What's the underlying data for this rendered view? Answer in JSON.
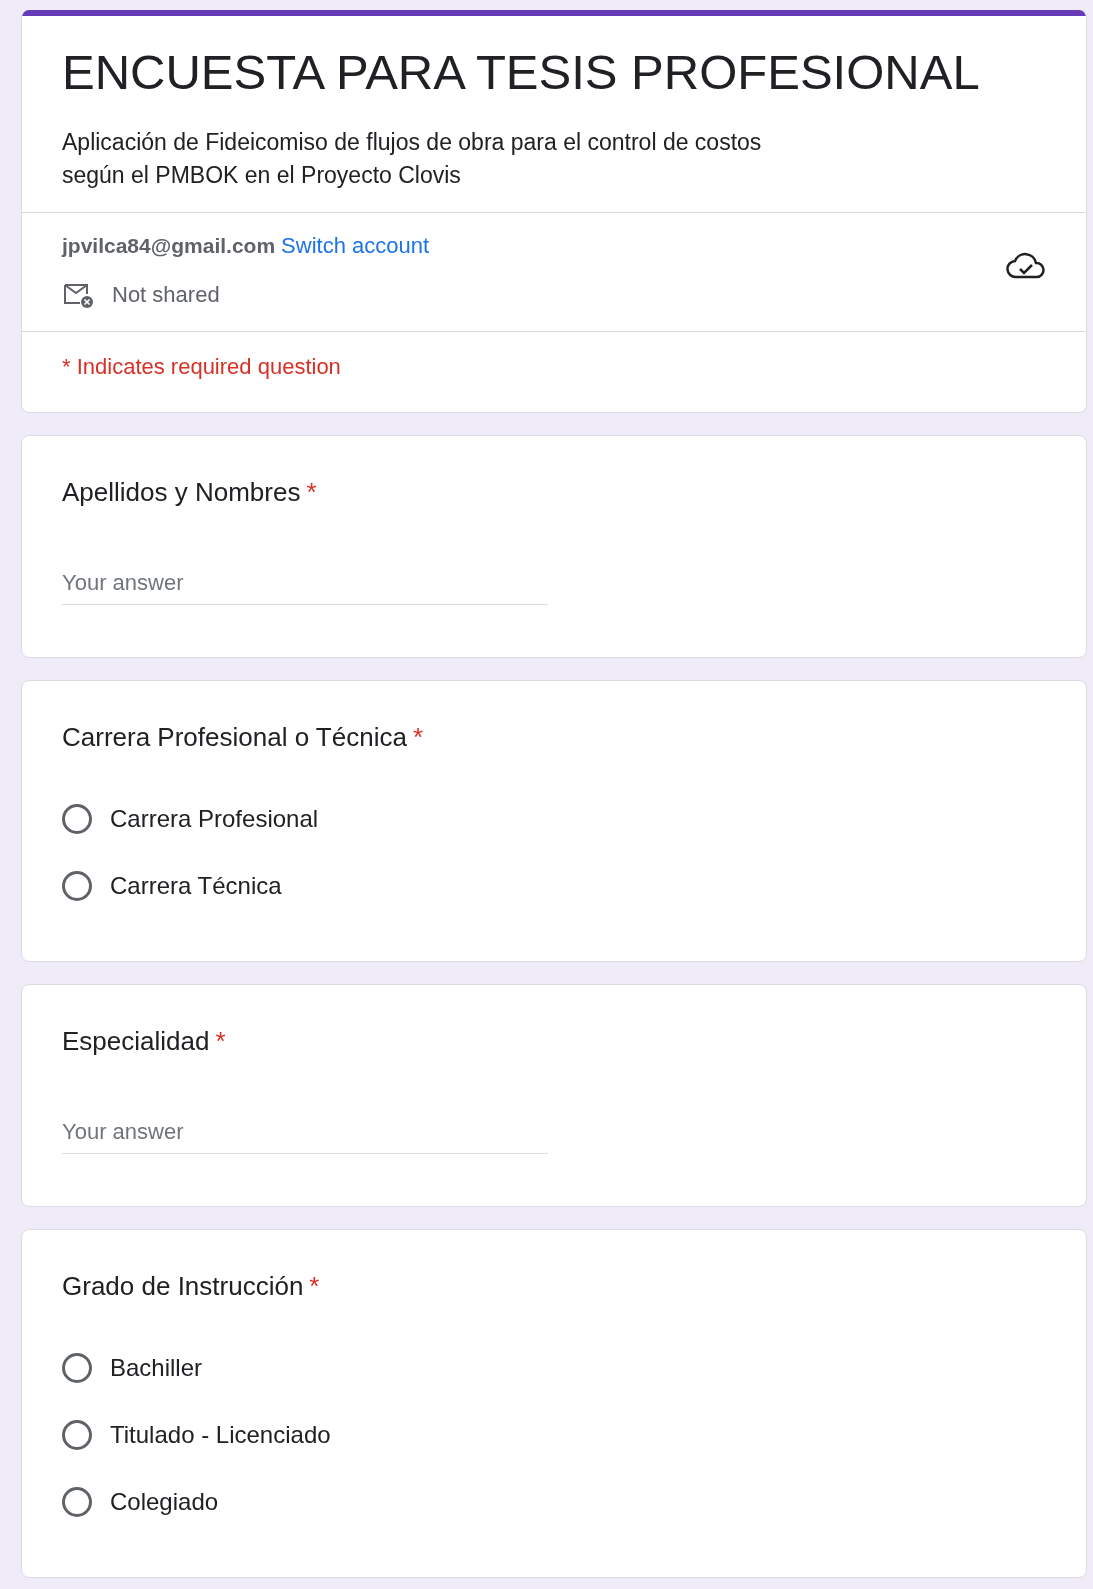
{
  "header": {
    "title": "ENCUESTA PARA TESIS PROFESIONAL",
    "description": "Aplicación de Fideicomiso de flujos de obra para el control de costos\nsegún el PMBOK en el Proyecto Clovis",
    "account": "jpvilca84@gmail.com",
    "switch_account": "Switch account",
    "sharing": "Not shared",
    "required_note": "* Indicates required question"
  },
  "questions": [
    {
      "kind": "text",
      "title": "Apellidos y Nombres",
      "required_mark": "*",
      "placeholder": "Your answer"
    },
    {
      "kind": "radio",
      "title": "Carrera Profesional o Técnica",
      "required_mark": "*",
      "options": [
        {
          "label": "Carrera Profesional",
          "selected": false
        },
        {
          "label": "Carrera Técnica",
          "selected": false
        }
      ]
    },
    {
      "kind": "text",
      "title": "Especialidad",
      "required_mark": "*",
      "placeholder": "Your answer"
    },
    {
      "kind": "radio",
      "title": "Grado de Instrucción",
      "required_mark": "*",
      "options": [
        {
          "label": "Bachiller",
          "selected": false
        },
        {
          "label": "Titulado - Licenciado",
          "selected": false
        },
        {
          "label": "Colegiado",
          "selected": false
        }
      ]
    }
  ]
}
